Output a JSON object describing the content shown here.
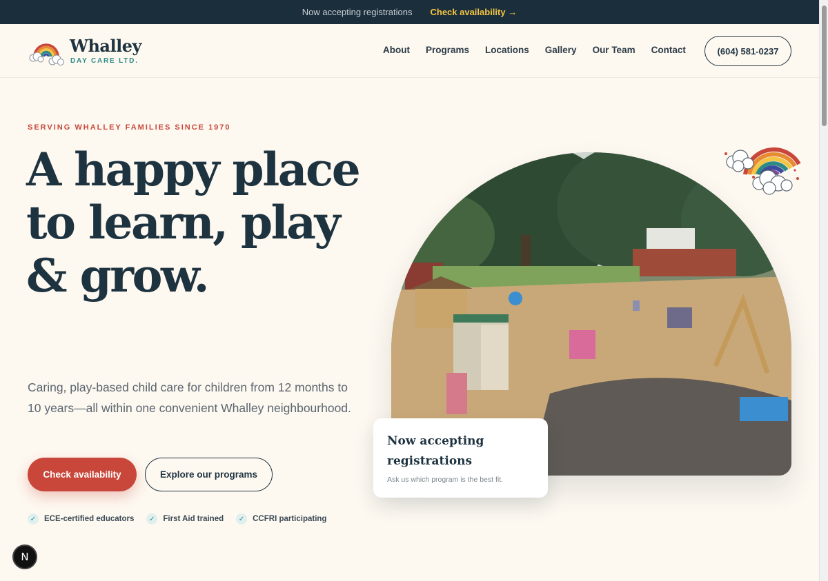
{
  "topbar": {
    "message": "Now accepting registrations",
    "cta": "Check availability →"
  },
  "brand": {
    "name": "Whalley",
    "sub": "DAY CARE LTD."
  },
  "nav": {
    "items": [
      {
        "label": "About"
      },
      {
        "label": "Programs"
      },
      {
        "label": "Locations"
      },
      {
        "label": "Gallery"
      },
      {
        "label": "Our Team"
      },
      {
        "label": "Contact"
      }
    ],
    "phone": "(604) 581-0237"
  },
  "hero": {
    "eyebrow": "SERVING WHALLEY FAMILIES SINCE 1970",
    "headline": "A happy place to learn, play & grow.",
    "lede": "Caring, play-based child care for children from 12 months to 10 years—all within one convenient Whalley neighbourhood.",
    "primary_cta": "Check availability",
    "secondary_cta": "Explore our programs",
    "badges": [
      {
        "label": "ECE-certified educators"
      },
      {
        "label": "First Aid trained"
      },
      {
        "label": "CCFRI participating"
      }
    ]
  },
  "card": {
    "title": "Now accepting registrations",
    "subtitle": "Ask us which program is the best fit."
  },
  "dev_badge": "N",
  "colors": {
    "navy": "#1b2e3b",
    "accent_red": "#c8463a",
    "teal": "#2d8a87",
    "gold": "#f4c544",
    "cream": "#fdf8f0"
  },
  "icons": {
    "check": "check-icon",
    "logo": "rainbow-logo-icon",
    "decoration": "rainbow-cloud-icon"
  }
}
